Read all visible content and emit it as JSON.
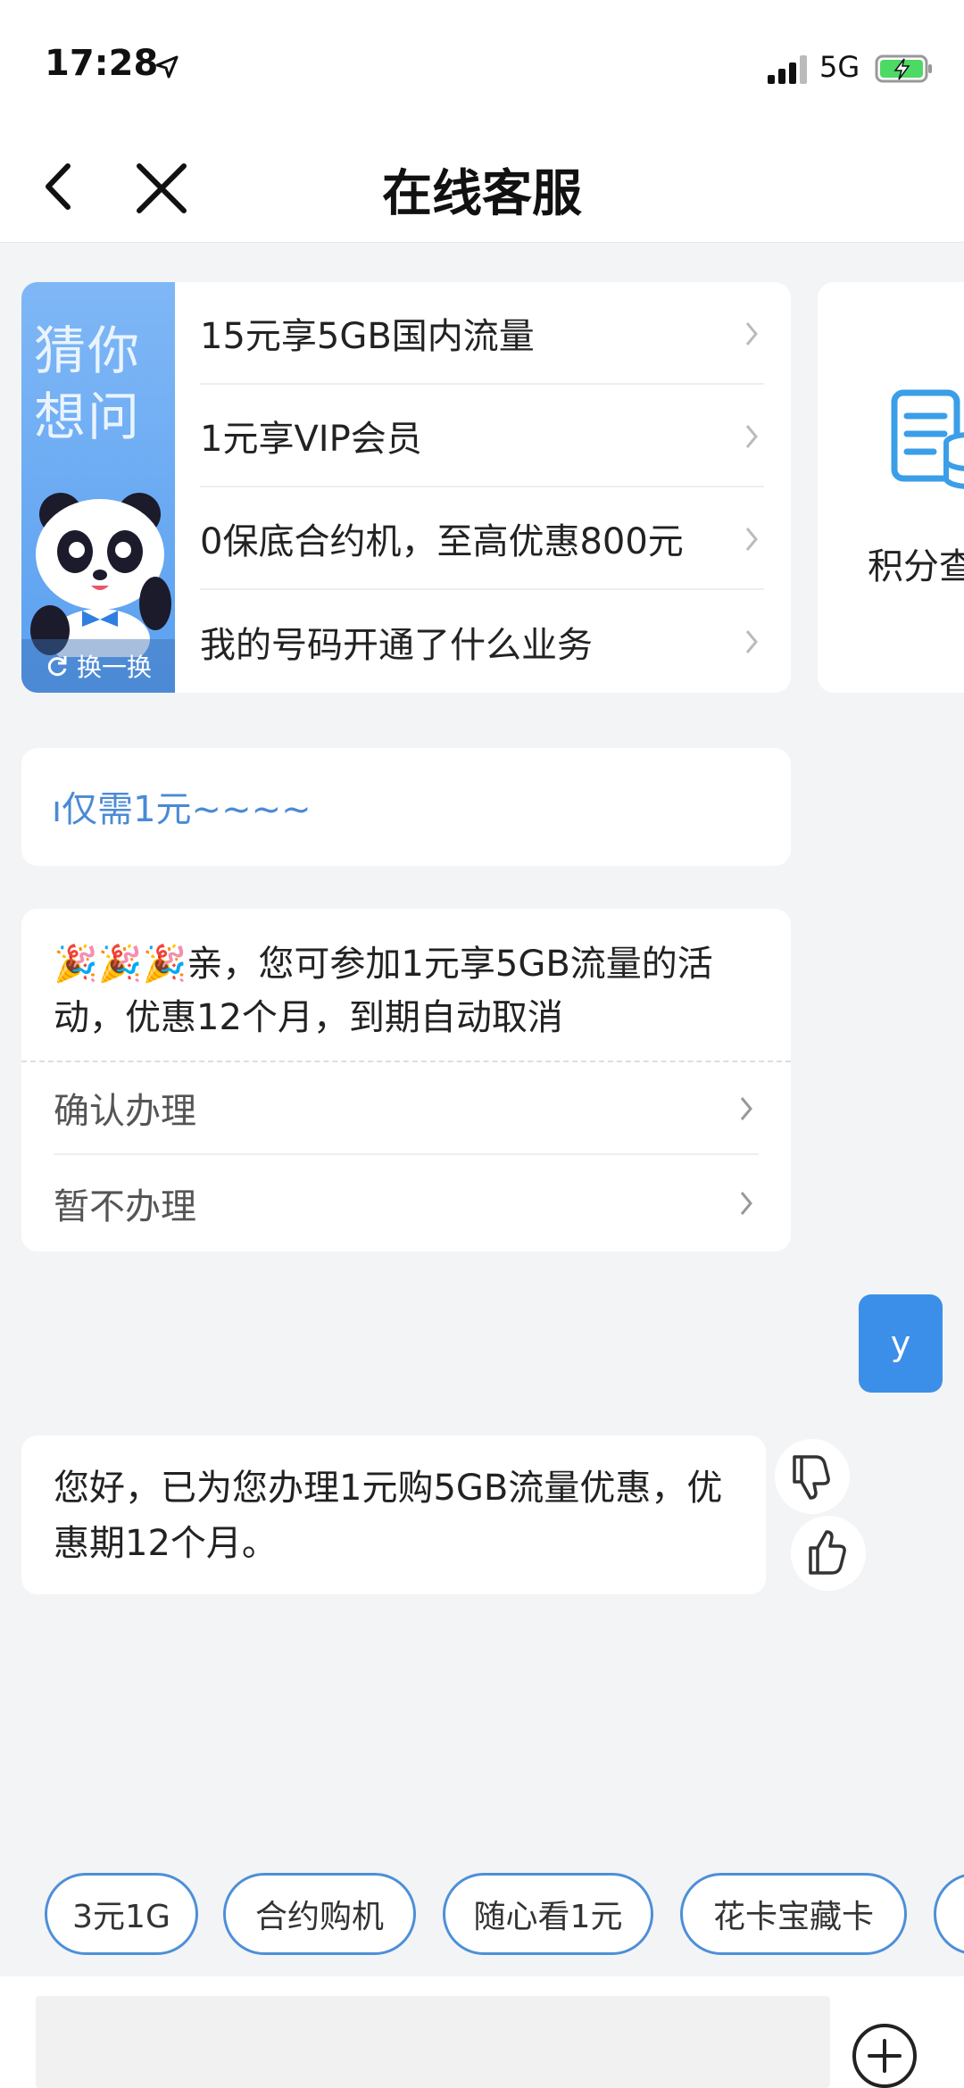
{
  "status_bar": {
    "time": "17:28",
    "network": "5G"
  },
  "nav": {
    "title": "在线客服"
  },
  "guess": {
    "side_title": "猜你想问",
    "refresh_label": "换一换",
    "items": [
      {
        "label": "15元享5GB国内流量"
      },
      {
        "label": "1元享VIP会员"
      },
      {
        "label": "0保底合约机，至高优惠800元"
      },
      {
        "label": "我的号码开通了什么业务"
      }
    ]
  },
  "side_card": {
    "label": "积分查"
  },
  "marquee": {
    "text": "ı仅需1元~~~~"
  },
  "promo": {
    "emojis": "🎉🎉🎉",
    "text": "亲，您可参加1元享5GB流量的活动，优惠12个月，到期自动取消",
    "options": [
      {
        "label": "确认办理"
      },
      {
        "label": "暂不办理"
      }
    ]
  },
  "user_message": {
    "text": "y"
  },
  "reply": {
    "text": "您好，已为您办理1元购5GB流量优惠，优惠期12个月。"
  },
  "quick_chips": [
    {
      "label": "3元1G"
    },
    {
      "label": "合约购机"
    },
    {
      "label": "随心看1元"
    },
    {
      "label": "花卡宝藏卡"
    }
  ],
  "colors": {
    "accent": "#3c8fe8",
    "chip_border": "#4d8fd8",
    "background": "#f3f4f6"
  }
}
